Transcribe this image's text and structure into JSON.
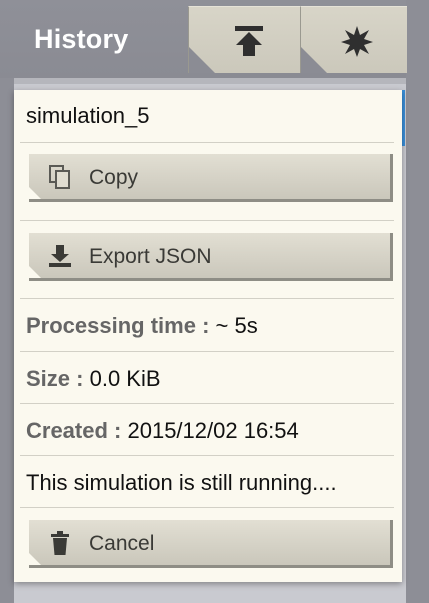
{
  "header": {
    "title": "History",
    "tabs": [
      {
        "icon": "upload-icon"
      },
      {
        "icon": "star-icon"
      }
    ]
  },
  "popup": {
    "name": "simulation_5",
    "copy_label": "Copy",
    "export_label": "Export JSON",
    "processing_label": "Processing time :",
    "processing_value": "~ 5s",
    "size_label": "Size :",
    "size_value": "0.0 KiB",
    "created_label": "Created :",
    "created_value": "2015/12/02 16:54",
    "status_text": "This simulation is still running....",
    "cancel_label": "Cancel"
  },
  "colors": {
    "header": "#8d8e96",
    "tab": "#d3d0c3",
    "card": "#fbf9ef",
    "accent": "#3a8fd8",
    "button": "#d6d3c7"
  }
}
